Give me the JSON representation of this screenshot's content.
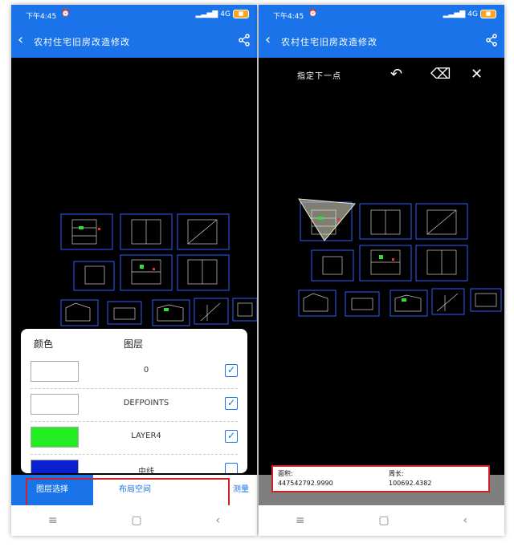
{
  "status": {
    "time": "下午4:45",
    "network": "4G"
  },
  "app": {
    "title": "农村住宅旧房改造修改"
  },
  "layers_panel": {
    "col_color": "颜色",
    "col_layer": "图层",
    "layers": [
      {
        "name": "0",
        "color": "#ffffff",
        "checked": true
      },
      {
        "name": "DEFPOINTS",
        "color": "#ffffff",
        "checked": true
      },
      {
        "name": "LAYER4",
        "color": "#22ee22",
        "checked": true
      },
      {
        "name": "中线",
        "color": "#0a1fd0",
        "checked": false
      }
    ]
  },
  "tabs": {
    "layer_select": "图层选择",
    "layout_space": "布局空间",
    "measure": "测量"
  },
  "measure": {
    "hint": "指定下一点",
    "area_label": "面积:",
    "area_value": "447542792.9990",
    "perimeter_label": "周长:",
    "perimeter_value": "100692.4382"
  },
  "colors": {
    "primary": "#1a73e8",
    "highlight": "#d0202a"
  }
}
